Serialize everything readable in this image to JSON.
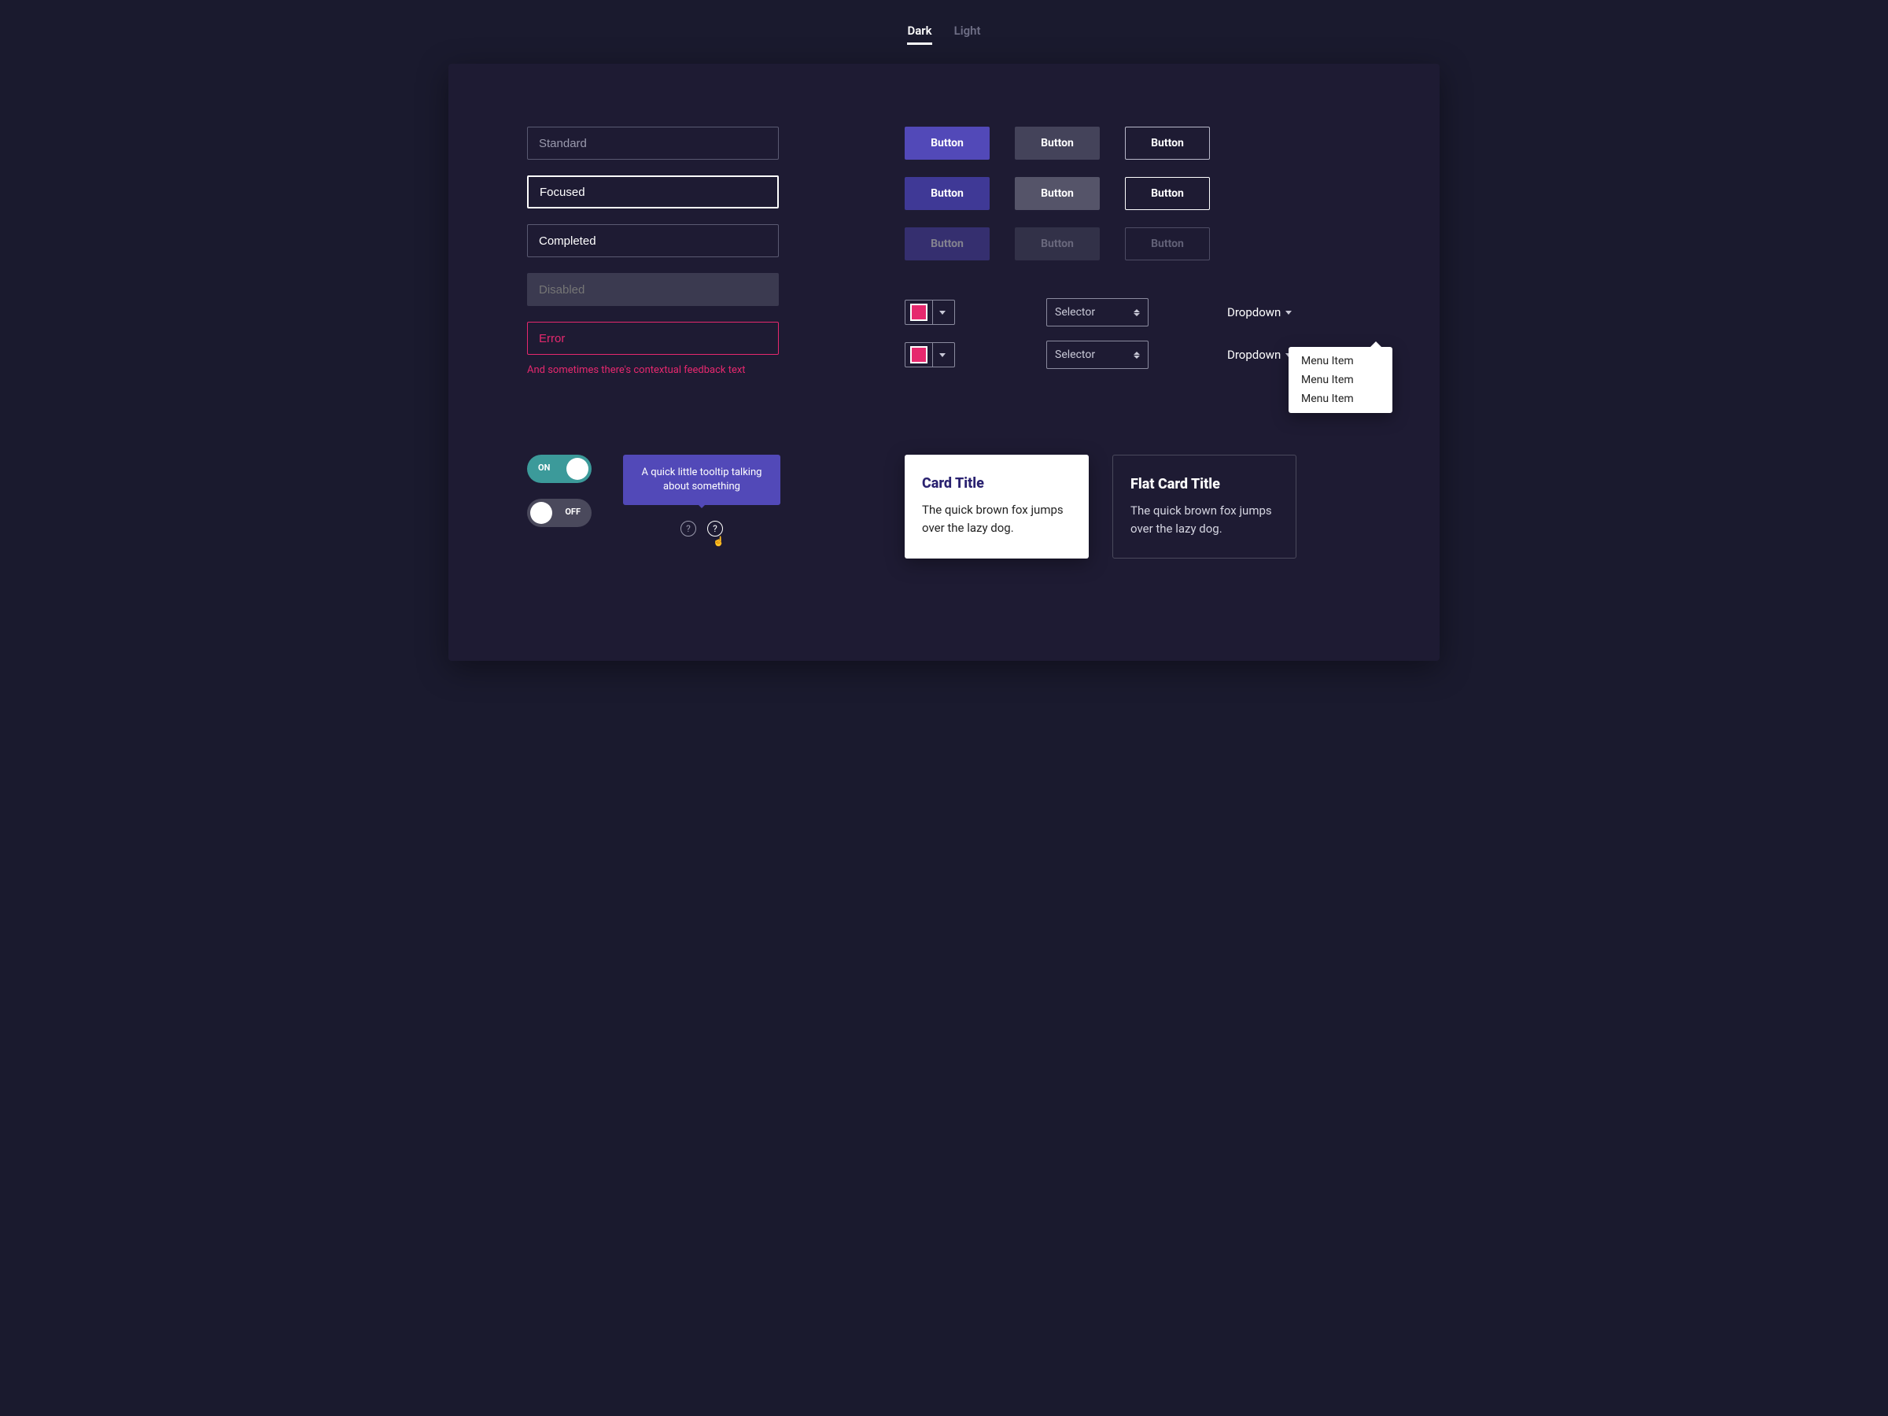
{
  "tabs": {
    "dark": "Dark",
    "light": "Light",
    "active": "dark"
  },
  "inputs": {
    "standard_placeholder": "Standard",
    "focused_value": "Focused",
    "completed_value": "Completed",
    "disabled_placeholder": "Disabled",
    "error_value": "Error",
    "error_feedback": "And sometimes there's contextual feedback text"
  },
  "buttons": {
    "label": "Button"
  },
  "colorpicker": {
    "swatch": "#e6286e"
  },
  "selector": {
    "label": "Selector"
  },
  "dropdown": {
    "label": "Dropdown",
    "items": [
      "Menu Item",
      "Menu Item",
      "Menu Item"
    ]
  },
  "toggles": {
    "on": "ON",
    "off": "OFF"
  },
  "tooltip": {
    "text": "A quick little tooltip talking about something"
  },
  "cards": {
    "light": {
      "title": "Card Title",
      "body": "The quick brown fox jumps over the lazy dog."
    },
    "flat": {
      "title": "Flat Card Title",
      "body": "The quick brown fox jumps over the lazy dog."
    }
  }
}
